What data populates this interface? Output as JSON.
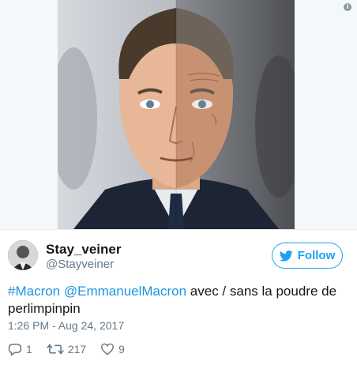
{
  "media": {
    "image_subject": "side-by-side portrait of a man in a suit, left half smooth skin, right half aged skin",
    "info_icon": "info-icon"
  },
  "author": {
    "display_name": "Stay_veiner",
    "handle": "@Stayveiner",
    "avatar_icon": "avatar"
  },
  "follow_button": {
    "label": "Follow",
    "icon": "bird-icon"
  },
  "tweet": {
    "hashtag": "#Macron",
    "mention": "@EmmanuelMacron",
    "text": " avec / sans la poudre de perlimpinpin",
    "timestamp": "1:26 PM - Aug 24, 2017"
  },
  "actions": {
    "replies": "1",
    "retweets": "217",
    "likes": "9"
  },
  "colors": {
    "accent": "#1da1f2",
    "link": "#1b95e0",
    "muted": "#657786"
  }
}
